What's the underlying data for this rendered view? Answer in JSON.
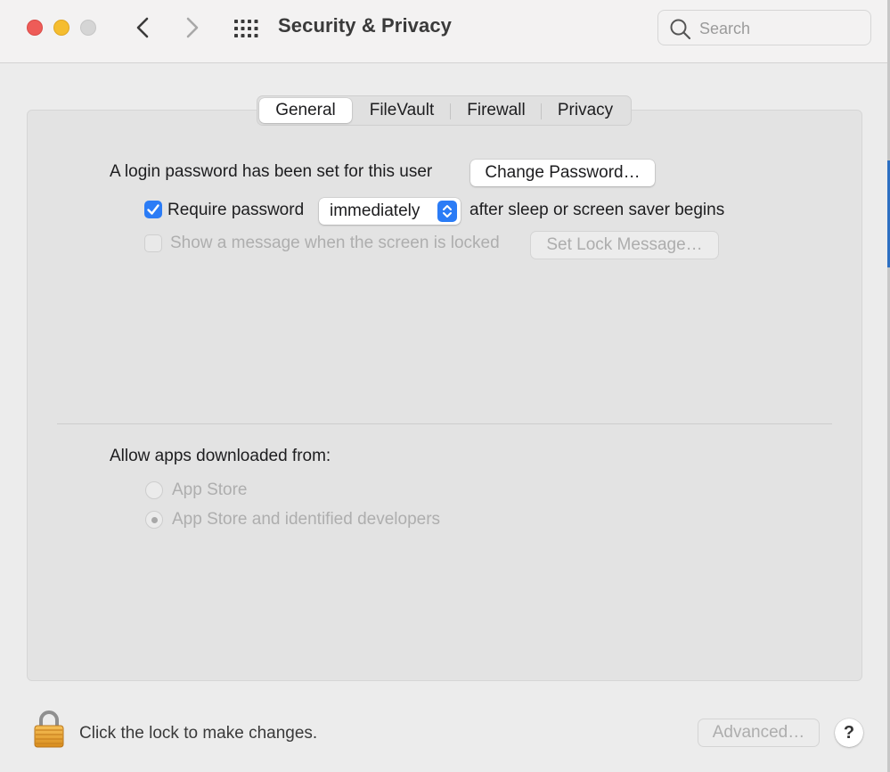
{
  "window": {
    "title": "Security & Privacy"
  },
  "search": {
    "placeholder": "Search",
    "value": ""
  },
  "tabs": [
    {
      "label": "General",
      "active": true
    },
    {
      "label": "FileVault",
      "active": false
    },
    {
      "label": "Firewall",
      "active": false
    },
    {
      "label": "Privacy",
      "active": false
    }
  ],
  "general": {
    "login_text": "A login password has been set for this user",
    "change_password_button": "Change Password…",
    "require_password": {
      "checked": true,
      "label": "Require password",
      "selected_option": "immediately",
      "suffix": "after sleep or screen saver begins"
    },
    "show_message": {
      "checked": false,
      "enabled": false,
      "label": "Show a message when the screen is locked",
      "button": "Set Lock Message…"
    },
    "allow_apps": {
      "label": "Allow apps downloaded from:",
      "options": [
        {
          "label": "App Store",
          "selected": false
        },
        {
          "label": "App Store and identified developers",
          "selected": true
        }
      ],
      "enabled": false
    }
  },
  "footer": {
    "lock_text": "Click the lock to make changes.",
    "advanced_button": "Advanced…",
    "help_glyph": "?"
  },
  "icons": {
    "back": "chevron-left-icon",
    "forward": "chevron-right-icon",
    "show_all": "grid-icon",
    "search": "search-icon",
    "lock": "lock-icon"
  },
  "colors": {
    "close": "#ee5c58",
    "minimize": "#f5bd2f",
    "zoom": "#d5d5d5",
    "accent": "#2b7cf6"
  }
}
